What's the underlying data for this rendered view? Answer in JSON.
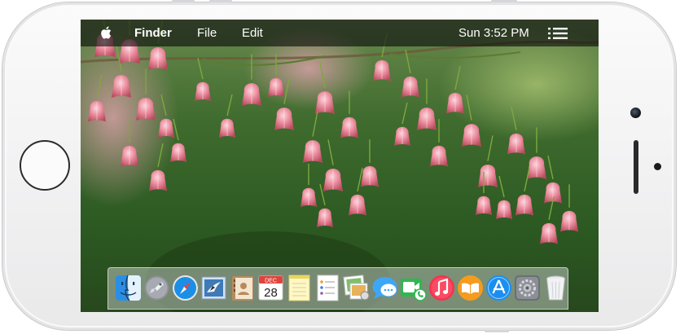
{
  "menubar": {
    "app_name": "Finder",
    "menus": [
      "File",
      "Edit"
    ],
    "clock": "Sun 3:52 PM",
    "apple_icon": "apple-logo-icon",
    "list_icon": "notification-list-icon"
  },
  "dock": {
    "items": [
      {
        "name": "Finder",
        "icon": "finder-icon"
      },
      {
        "name": "Launchpad",
        "icon": "launchpad-icon"
      },
      {
        "name": "Safari",
        "icon": "safari-icon"
      },
      {
        "name": "Mail",
        "icon": "mail-icon"
      },
      {
        "name": "Contacts",
        "icon": "contacts-icon"
      },
      {
        "name": "Calendar",
        "icon": "calendar-icon",
        "month": "DEC",
        "day": "28"
      },
      {
        "name": "Notes",
        "icon": "notes-icon"
      },
      {
        "name": "Reminders",
        "icon": "reminders-icon"
      },
      {
        "name": "Photo Booth",
        "icon": "photo-booth-icon"
      },
      {
        "name": "Messages",
        "icon": "messages-icon"
      },
      {
        "name": "FaceTime",
        "icon": "facetime-icon"
      },
      {
        "name": "iTunes",
        "icon": "itunes-icon"
      },
      {
        "name": "iBooks",
        "icon": "ibooks-icon"
      },
      {
        "name": "App Store",
        "icon": "app-store-icon"
      },
      {
        "name": "System Preferences",
        "icon": "system-preferences-icon"
      },
      {
        "name": "Trash",
        "icon": "trash-icon"
      }
    ]
  },
  "colors": {
    "phone_body": "#f3f3f4",
    "menubar_bg": "#1a1a1a",
    "wallpaper_foliage": "#3d6b2c",
    "flower_pink": "#e88295"
  },
  "wallpaper": "pink-bell-flowers"
}
